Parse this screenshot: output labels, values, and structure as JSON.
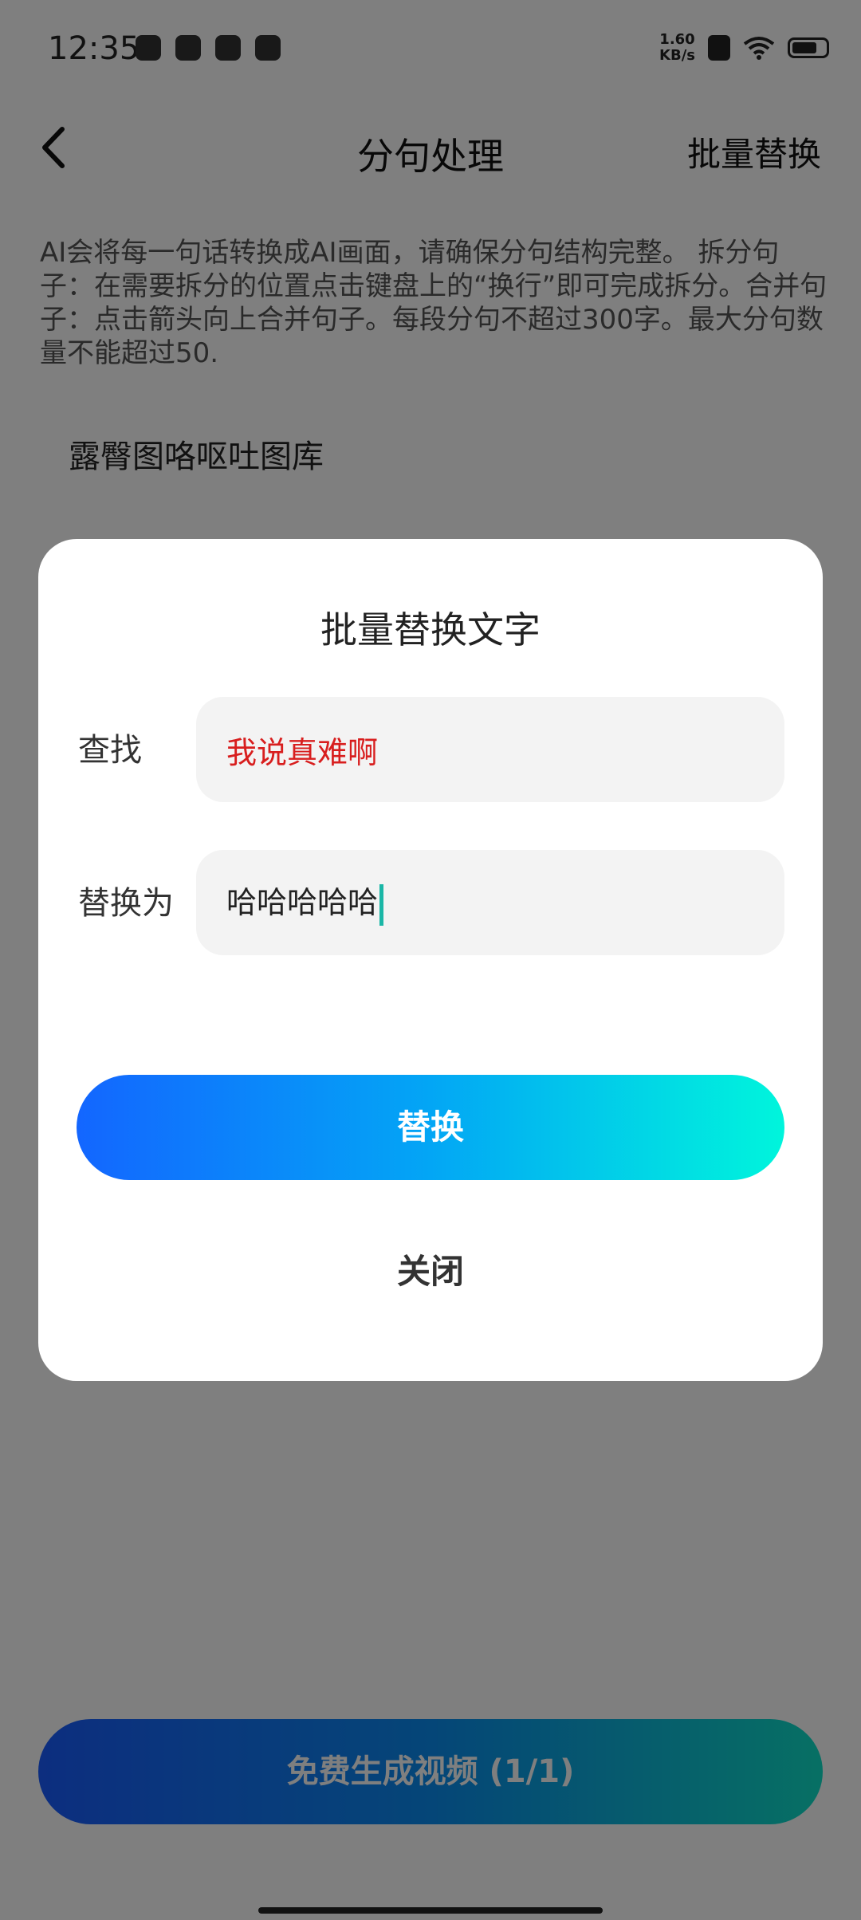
{
  "status_bar": {
    "time": "12:35",
    "net_speed_value": "1.60",
    "net_speed_unit": "KB/s",
    "battery_level": 0.75
  },
  "nav": {
    "title": "分句处理",
    "action": "批量替换"
  },
  "instructions": "AI会将每一句话转换成AI画面，请确保分句结构完整。 拆分句子：在需要拆分的位置点击键盘上的“换行”即可完成拆分。合并句子：点击箭头向上合并句子。每段分句不超过300字。最大分句数量不能超过50.",
  "sentences": [
    "露臀图咯呕吐图库"
  ],
  "generate_button": "免费生成视频 (1/1)",
  "dialog": {
    "title": "批量替换文字",
    "find_label": "查找",
    "find_value": "我说真难啊",
    "replace_label": "替换为",
    "replace_value": "哈哈哈哈哈",
    "replace_button": "替换",
    "close_button": "关闭"
  },
  "colors": {
    "find_text": "#d81e1e",
    "cursor": "#1ab6a6",
    "button_gradient_start": "#1366ff",
    "button_gradient_end": "#00f5dc"
  }
}
